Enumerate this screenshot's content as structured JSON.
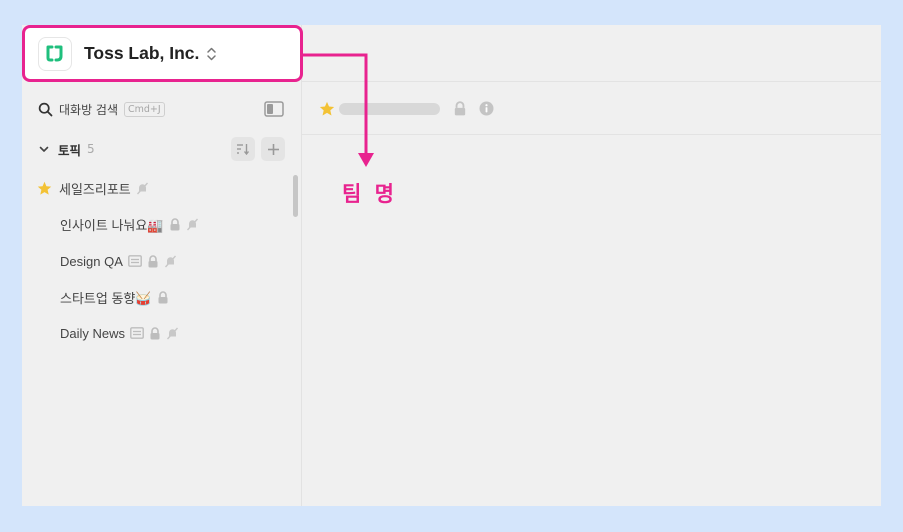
{
  "colors": {
    "accent": "#e8238f",
    "logo_green": "#1fbf7d",
    "star": "#f3c235",
    "canvas": "#d4e5fb"
  },
  "team": {
    "name": "Toss Lab, Inc.",
    "logo_icon": "tosslab-logo-icon",
    "switch_icon": "chevron-updown-icon"
  },
  "sidebar": {
    "search": {
      "label": "대화방 검색",
      "shortcut": "Cmd+J"
    },
    "topics": {
      "title": "토픽",
      "count": "5"
    },
    "items": [
      {
        "label": "세일즈리포트",
        "starred": true
      },
      {
        "label": "인사이트 나눠요🏭"
      },
      {
        "label": "Design QA"
      },
      {
        "label": "스타트업 동향🥁"
      },
      {
        "label": "Daily News"
      }
    ]
  },
  "annotation": {
    "label": "팀 명"
  }
}
